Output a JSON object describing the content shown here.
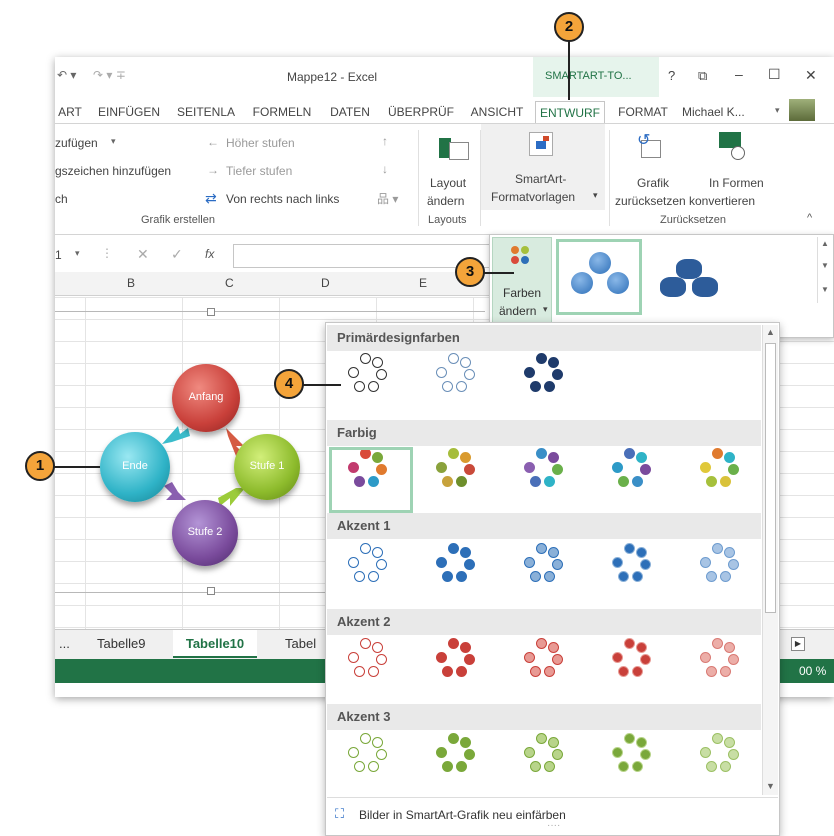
{
  "window": {
    "title": "Mappe12 - Excel",
    "context_tab": "SMARTART-TO...",
    "help": "?",
    "user": "Michael K...",
    "controls": {
      "restore": "⧉",
      "minimize": "–",
      "maximize": "☐",
      "close": "✕"
    }
  },
  "tabs": [
    "ART",
    "EINFÜGEN",
    "SEITENLA",
    "FORMELN",
    "DATEN",
    "ÜBERPRÜF",
    "ANSICHT",
    "ENTWURF",
    "FORMAT"
  ],
  "ribbon": {
    "create": {
      "add_shape": "zufügen",
      "add_bullet": "gszeichen hinzufügen",
      "text_pane": "ch",
      "promote": "Höher stufen",
      "demote": "Tiefer stufen",
      "rtl": "Von rechts nach links",
      "group_label": "Grafik erstellen"
    },
    "layouts": {
      "change": "Layout",
      "change2": "ändern",
      "group_label": "Layouts"
    },
    "styles": {
      "label1": "SmartArt-",
      "label2": "Formatvorlagen"
    },
    "reset": {
      "reset_graphic1": "Grafik",
      "reset_graphic2": "zurücksetzen",
      "convert1": "In Formen",
      "convert2": "konvertieren",
      "group_label": "Zurücksetzen"
    }
  },
  "formula_bar": {
    "name_box": "1",
    "fx": "fx"
  },
  "columns": [
    "B",
    "C",
    "D",
    "E"
  ],
  "smartart": {
    "nodes": [
      {
        "label": "Anfang",
        "color": "#c9403a"
      },
      {
        "label": "Stufe 1",
        "color": "#8dbb2c"
      },
      {
        "label": "Stufe 2",
        "color": "#7a4b9c"
      },
      {
        "label": "Ende",
        "color": "#2fb3c7"
      }
    ]
  },
  "sheets": [
    "...",
    "Tabelle9",
    "Tabelle10",
    "Tabel"
  ],
  "status": {
    "zoom": "00 %"
  },
  "flyout": {
    "button1": "Farben",
    "button2": "ändern"
  },
  "panel": {
    "sections": [
      {
        "title": "Primärdesignfarben"
      },
      {
        "title": "Farbig"
      },
      {
        "title": "Akzent 1"
      },
      {
        "title": "Akzent 2"
      },
      {
        "title": "Akzent 3"
      }
    ],
    "footer": "Bilder in SmartArt-Grafik neu einfärben"
  },
  "callouts": [
    "1",
    "2",
    "3",
    "4"
  ]
}
